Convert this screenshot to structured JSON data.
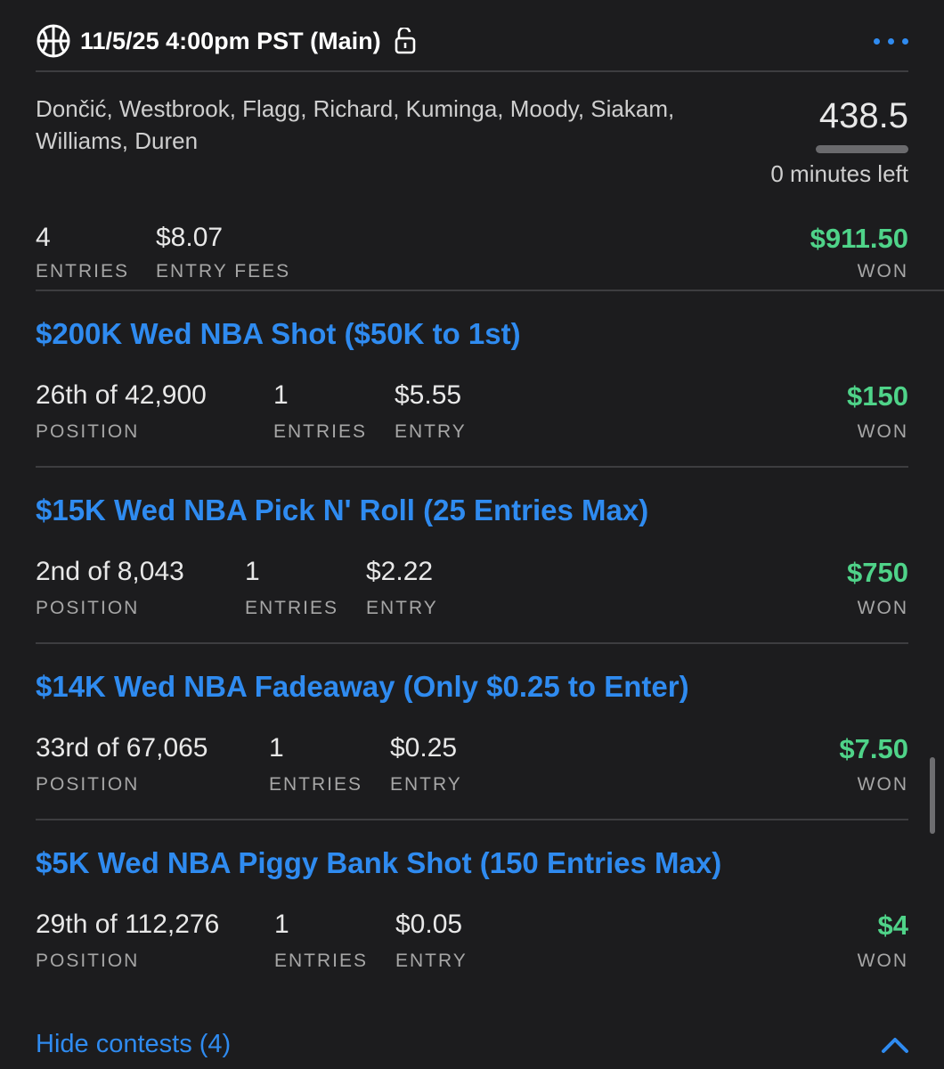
{
  "header": {
    "slate": "11/5/25 4:00pm PST (Main)",
    "sport_icon": "basketball-icon",
    "lock_icon": "unlock-icon",
    "menu_icon": "more-horizontal-icon"
  },
  "lineup": {
    "players": "Dončić, Westbrook, Flagg, Richard, Kuminga, Moody, Siakam, Williams, Duren",
    "score": "438.5",
    "time_left": "0 minutes left"
  },
  "summary": {
    "entries_value": "4",
    "entries_label": "ENTRIES",
    "fees_value": "$8.07",
    "fees_label": "ENTRY FEES",
    "won_value": "$911.50",
    "won_label": "WON"
  },
  "contests": [
    {
      "title": "$200K Wed NBA Shot ($50K to 1st)",
      "position": "26th of 42,900",
      "position_label": "POSITION",
      "entries": "1",
      "entries_label": "ENTRIES",
      "entry": "$5.55",
      "entry_label": "ENTRY",
      "won": "$150",
      "won_label": "WON"
    },
    {
      "title": "$15K Wed NBA Pick N' Roll (25 Entries Max)",
      "position": "2nd of 8,043",
      "position_label": "POSITION",
      "entries": "1",
      "entries_label": "ENTRIES",
      "entry": "$2.22",
      "entry_label": "ENTRY",
      "won": "$750",
      "won_label": "WON"
    },
    {
      "title": "$14K Wed NBA Fadeaway (Only $0.25 to Enter)",
      "position": "33rd of 67,065",
      "position_label": "POSITION",
      "entries": "1",
      "entries_label": "ENTRIES",
      "entry": "$0.25",
      "entry_label": "ENTRY",
      "won": "$7.50",
      "won_label": "WON"
    },
    {
      "title": "$5K Wed NBA Piggy Bank Shot (150 Entries Max)",
      "position": "29th of 112,276",
      "position_label": "POSITION",
      "entries": "1",
      "entries_label": "ENTRIES",
      "entry": "$0.05",
      "entry_label": "ENTRY",
      "won": "$4",
      "won_label": "WON"
    }
  ],
  "footer": {
    "hide_label": "Hide contests (4)",
    "chevron_icon": "chevron-up-icon"
  },
  "colors": {
    "background": "#1c1c1e",
    "accent_blue": "#2f8bf0",
    "won_green": "#4fd389",
    "divider": "#3d3d40"
  }
}
